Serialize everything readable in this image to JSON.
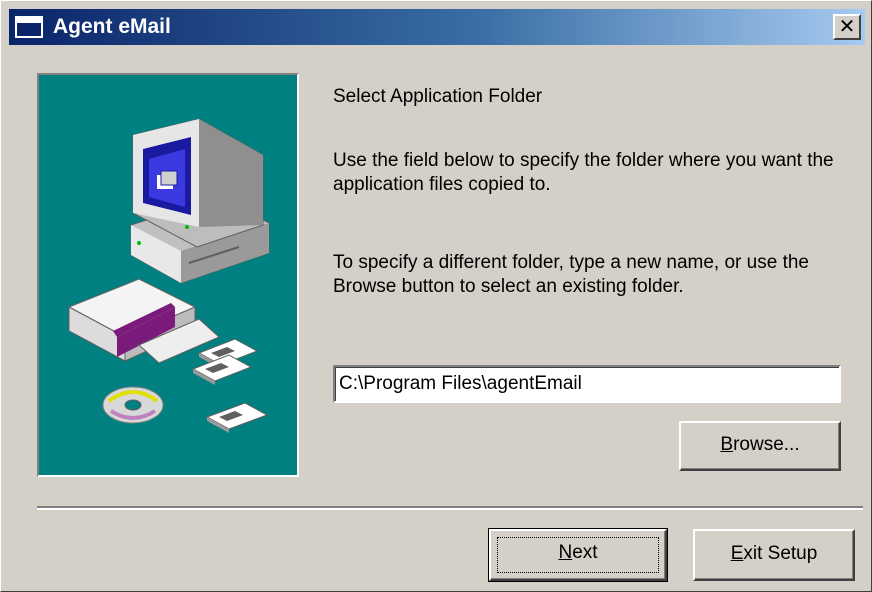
{
  "window": {
    "title": "Agent eMail",
    "close_glyph": "✕"
  },
  "content": {
    "heading": "Select Application Folder",
    "paragraph1": "Use the field below to specify the folder where you want the application files copied to.",
    "paragraph2": "To specify a different folder, type a new name, or use the Browse button to select an existing folder.",
    "folder_path": "C:\\Program Files\\agentEmail"
  },
  "buttons": {
    "browse": {
      "mnemonic": "B",
      "rest": "rowse..."
    },
    "next": {
      "mnemonic": "N",
      "rest": "ext"
    },
    "exit": {
      "mnemonic": "E",
      "rest": "xit Setup"
    }
  },
  "colors": {
    "titlebar_start": "#0a246a",
    "titlebar_end": "#a6caf0",
    "art_background": "#008080",
    "dialog_background": "#d4d0c8"
  },
  "icons": [
    "window-icon",
    "close-icon",
    "computer-illustration",
    "box-illustration",
    "floppy-disk-icon",
    "cd-disc-icon"
  ]
}
